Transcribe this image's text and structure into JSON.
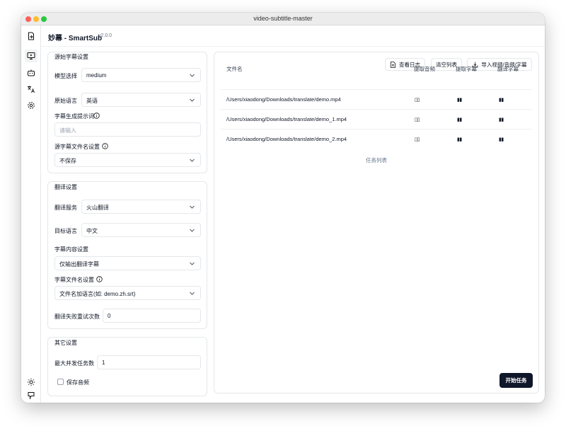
{
  "window": {
    "title": "video-subtitle-master"
  },
  "app": {
    "name": "妙幕 - SmartSub",
    "version": "v2.0.0"
  },
  "sidebar": {
    "items": [
      {
        "icon": "import-file-icon"
      },
      {
        "icon": "monitor-play-icon"
      },
      {
        "icon": "bot-icon"
      },
      {
        "icon": "languages-icon"
      },
      {
        "icon": "settings-gear-icon"
      }
    ],
    "bottom": [
      {
        "icon": "sun-icon"
      },
      {
        "icon": "github-icon"
      }
    ]
  },
  "source_settings": {
    "title": "源始字幕设置",
    "model_label": "模型选择",
    "model_value": "medium",
    "lang_label": "原始语言",
    "lang_value": "英语",
    "prompt_label": "字幕生成提示词",
    "prompt_placeholder": "请输入",
    "filename_label": "源字幕文件名设置",
    "filename_value": "不保存"
  },
  "translate_settings": {
    "title": "翻译设置",
    "service_label": "翻译服务",
    "service_value": "火山翻译",
    "target_label": "目标语言",
    "target_value": "中文",
    "content_label": "字幕内容设置",
    "content_value": "仅输出翻译字幕",
    "filename_label": "字幕文件名设置",
    "filename_value": "文件名加语言(如: demo.zh.srt)",
    "retry_label": "翻译失败重试次数",
    "retry_value": "0"
  },
  "other_settings": {
    "title": "其它设置",
    "concurrency_label": "最大并发任务数",
    "concurrency_value": "1",
    "save_audio_label": "保存音频"
  },
  "toolbar": {
    "log_label": "查看日志",
    "clear_label": "清空列表",
    "import_label": "导入视频/音频/字幕"
  },
  "table": {
    "headers": [
      "文件名",
      "提取音频",
      "提取字幕",
      "翻译字幕"
    ],
    "rows": [
      {
        "file": "/Users/xiaodong/Downloads/translate/demo.mp4",
        "audio": "▯▯",
        "subtitle": "▮▮",
        "translate": "▮▮"
      },
      {
        "file": "/Users/xiaodong/Downloads/translate/demo_1.mp4",
        "audio": "▯▯",
        "subtitle": "▮▮",
        "translate": "▮▮"
      },
      {
        "file": "/Users/xiaodong/Downloads/translate/demo_2.mp4",
        "audio": "▯▯",
        "subtitle": "▮▮",
        "translate": "▮▮"
      }
    ],
    "caption": "任务列表"
  },
  "start_button": "开始任务",
  "colors": {
    "primary": "#0f172a",
    "border": "#e5e7eb",
    "muted": "#64748b"
  }
}
